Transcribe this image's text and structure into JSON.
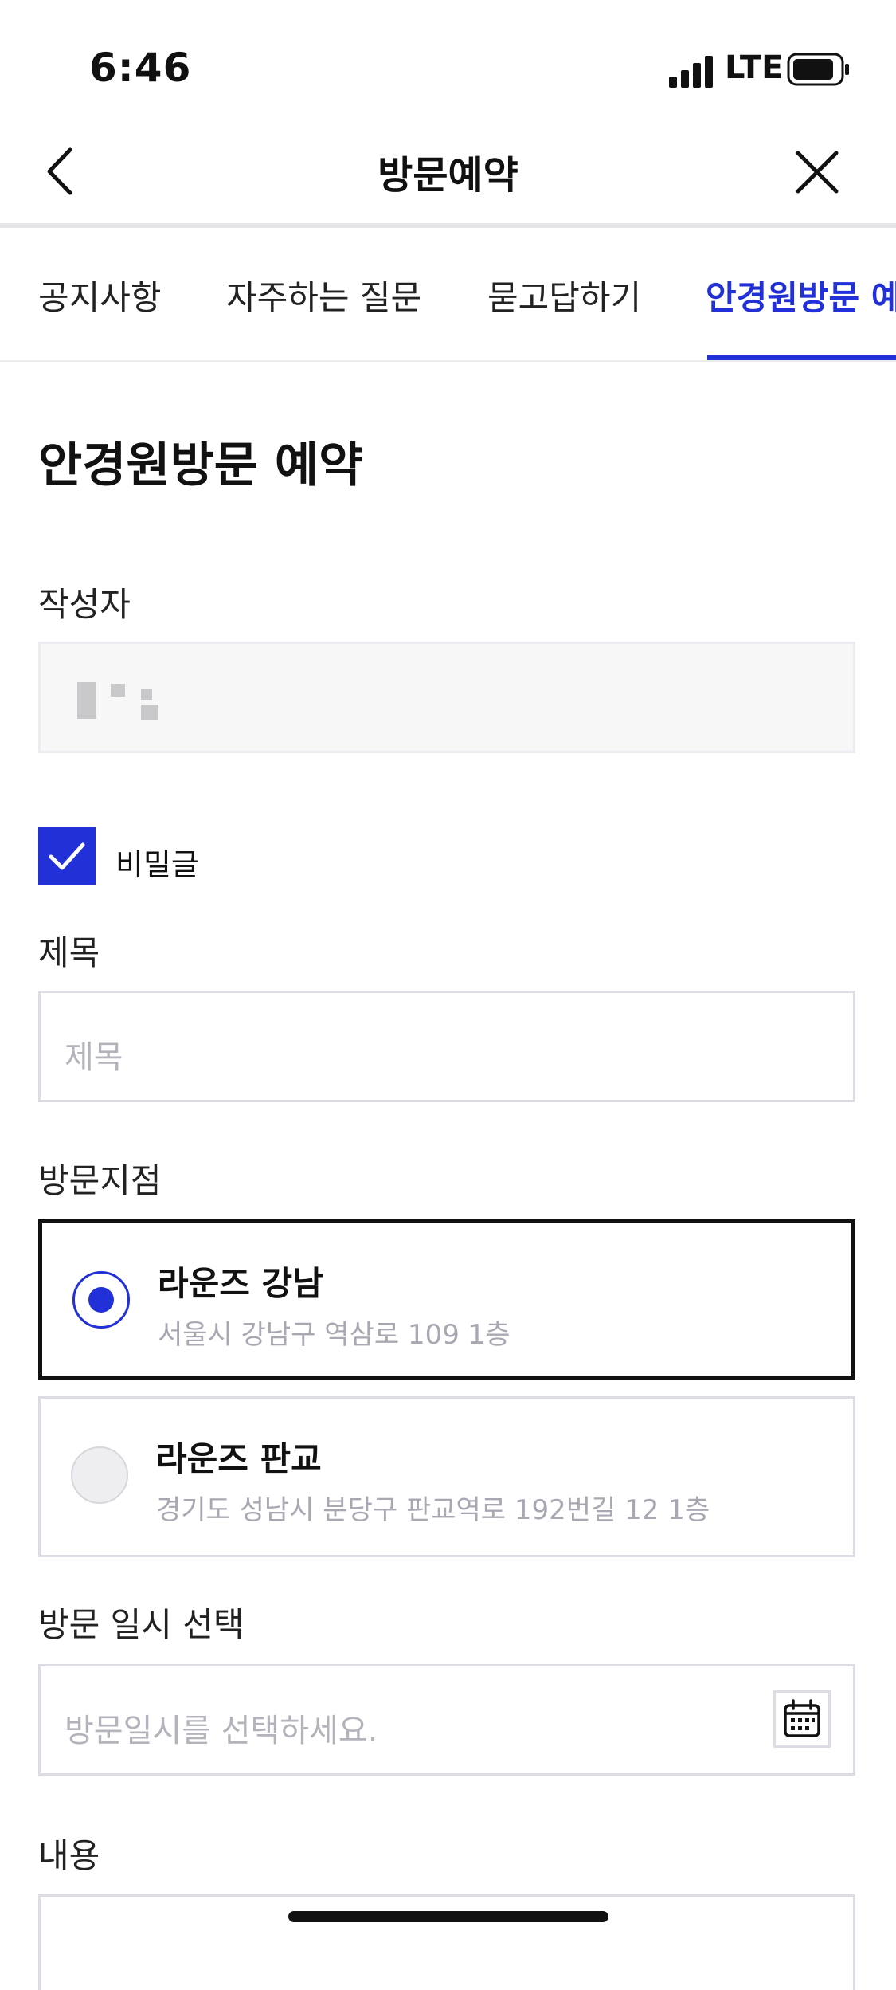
{
  "status_bar": {
    "time": "6:46",
    "network": "LTE",
    "icons": [
      "signal-icon",
      "battery-icon"
    ]
  },
  "header": {
    "title": "방문예약",
    "back_icon": "chevron-left-icon",
    "close_icon": "close-icon"
  },
  "tabs": [
    {
      "label": "공지사항",
      "active": false
    },
    {
      "label": "자주하는 질문",
      "active": false
    },
    {
      "label": "묻고답하기",
      "active": false
    },
    {
      "label": "안경원방문 예",
      "active": true
    }
  ],
  "form": {
    "title": "안경원방문 예약",
    "author": {
      "label": "작성자",
      "value_obscured": true
    },
    "secret": {
      "label": "비밀글",
      "checked": true
    },
    "subject": {
      "label": "제목",
      "placeholder": "제목",
      "value": ""
    },
    "branch": {
      "label": "방문지점",
      "options": [
        {
          "name": "라운즈 강남",
          "address": "서울시 강남구 역삼로 109 1층",
          "selected": true
        },
        {
          "name": "라운즈 판교",
          "address": "경기도 성남시 분당구 판교역로 192번길 12 1층",
          "selected": false
        }
      ]
    },
    "visit_datetime": {
      "label": "방문 일시 선택",
      "placeholder": "방문일시를 선택하세요.",
      "icon": "calendar-icon"
    },
    "content": {
      "label": "내용"
    }
  },
  "colors": {
    "accent": "#2230d8",
    "border": "#dcdce4",
    "placeholder": "#b3b3bb"
  }
}
